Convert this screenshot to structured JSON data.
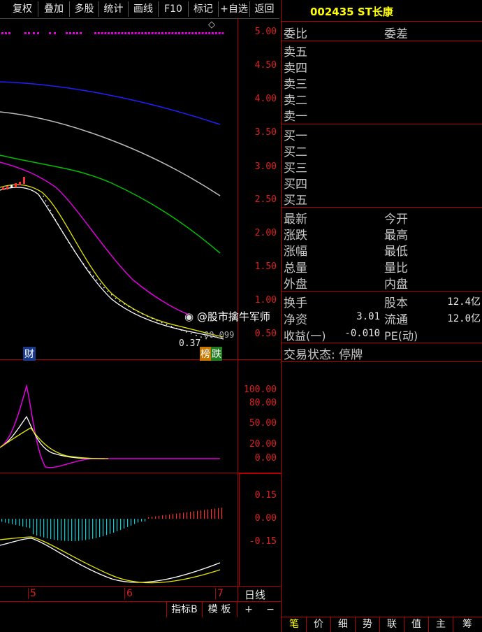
{
  "toolbar": {
    "buttons": [
      "复权",
      "叠加",
      "多股",
      "统计",
      "画线",
      "F10",
      "标记",
      "+自选",
      "返回"
    ]
  },
  "stock": {
    "code": "002435",
    "name": "ST长康"
  },
  "main_chart": {
    "y_labels": [
      "5.00",
      "4.50",
      "4.00",
      "3.50",
      "3.00",
      "2.50",
      "2.00",
      "1.50",
      "1.00",
      "0.50"
    ],
    "price_low_label": "0.37",
    "badge_cai": "财",
    "badge_bang": "榜",
    "badge_die": "跌",
    "watermark": "@股市擒牛军师",
    "overlay_value": "00.099"
  },
  "indicator1": {
    "y_labels": [
      "100.00",
      "80.00",
      "50.00",
      "20.00",
      "0.00"
    ]
  },
  "indicator2": {
    "y_labels": [
      "0.15",
      "0.00",
      "-0.15"
    ]
  },
  "x_axis": {
    "labels": [
      "5",
      "6",
      "7"
    ],
    "period": "日线"
  },
  "bottom_bar": {
    "indicator_label": "指标B",
    "template_label": "模 板",
    "plus": "+",
    "minus": "−"
  },
  "quote": {
    "weibi": "委比",
    "weicha": "委差",
    "sell": [
      "卖五",
      "卖四",
      "卖三",
      "卖二",
      "卖一"
    ],
    "buy": [
      "买一",
      "买二",
      "买三",
      "买四",
      "买五"
    ],
    "zuixin": "最新",
    "jinkai": "今开",
    "zhangdie": "涨跌",
    "zuigao": "最高",
    "zhangfu": "涨幅",
    "zuidi": "最低",
    "zongliang": "总量",
    "liangbi": "量比",
    "waipan": "外盘",
    "neipan": "内盘",
    "huanshou": "换手",
    "guben": "股本",
    "guben_val": "12.4亿",
    "jingzi": "净资",
    "jingzi_val": "3.01",
    "liutong": "流通",
    "liutong_val": "12.0亿",
    "shouyi": "收益(一)",
    "shouyi_val": "-0.010",
    "pe": "PE(动)",
    "trade_status": "交易状态: 停牌"
  },
  "bottom_tabs": [
    "笔",
    "价",
    "细",
    "势",
    "联",
    "值",
    "主",
    "筹"
  ],
  "colors": {
    "grid": "#b00000",
    "title": "#ffff00",
    "axis_label": "#e02020"
  }
}
